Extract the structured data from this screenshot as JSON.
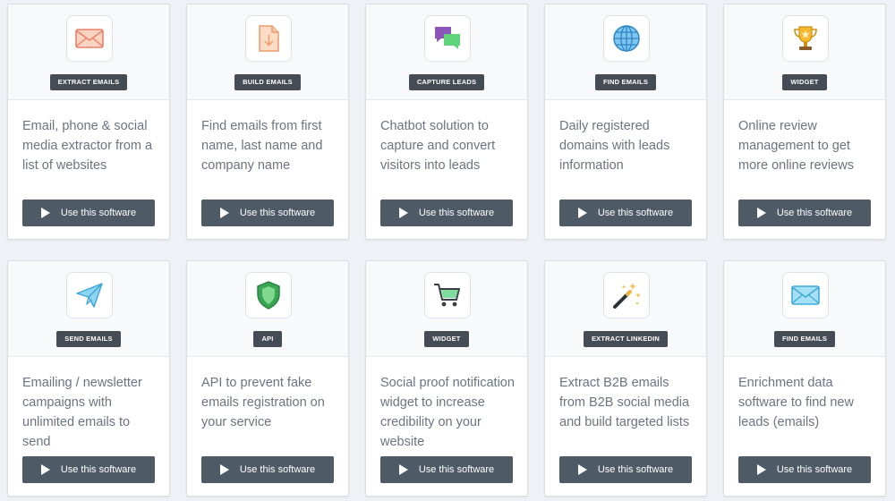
{
  "button_label": "Use this software",
  "cards": [
    {
      "icon": "envelope-icon",
      "badge": "EXTRACT EMAILS",
      "description": "Email, phone & social media extractor from a list of websites"
    },
    {
      "icon": "document-download-icon",
      "badge": "BUILD EMAILS",
      "description": "Find emails from first name, last name and company name"
    },
    {
      "icon": "chat-bubbles-icon",
      "badge": "CAPTURE LEADS",
      "description": "Chatbot solution to capture and convert visitors into leads"
    },
    {
      "icon": "globe-icon",
      "badge": "FIND EMAILS",
      "description": "Daily registered domains with leads information"
    },
    {
      "icon": "trophy-icon",
      "badge": "WIDGET",
      "description": "Online review management to get more online reviews"
    },
    {
      "icon": "paper-plane-icon",
      "badge": "SEND EMAILS",
      "description": "Emailing / newsletter campaigns with unlimited emails to send"
    },
    {
      "icon": "shield-icon",
      "badge": "API",
      "description": "API to prevent fake emails registration on your service"
    },
    {
      "icon": "shopping-cart-icon",
      "badge": "WIDGET",
      "description": "Social proof notification widget to increase credibility on your website"
    },
    {
      "icon": "magic-wand-icon",
      "badge": "EXTRACT LINKEDIN",
      "description": "Extract B2B emails from B2B social media and build targeted lists"
    },
    {
      "icon": "envelope-blue-icon",
      "badge": "FIND EMAILS",
      "description": "Enrichment data software to find new leads (emails)"
    }
  ],
  "colors": {
    "page_bg": "#eef1f5",
    "badge_bg": "#454c56",
    "button_bg": "#4f5a67",
    "text": "#6b7480"
  }
}
